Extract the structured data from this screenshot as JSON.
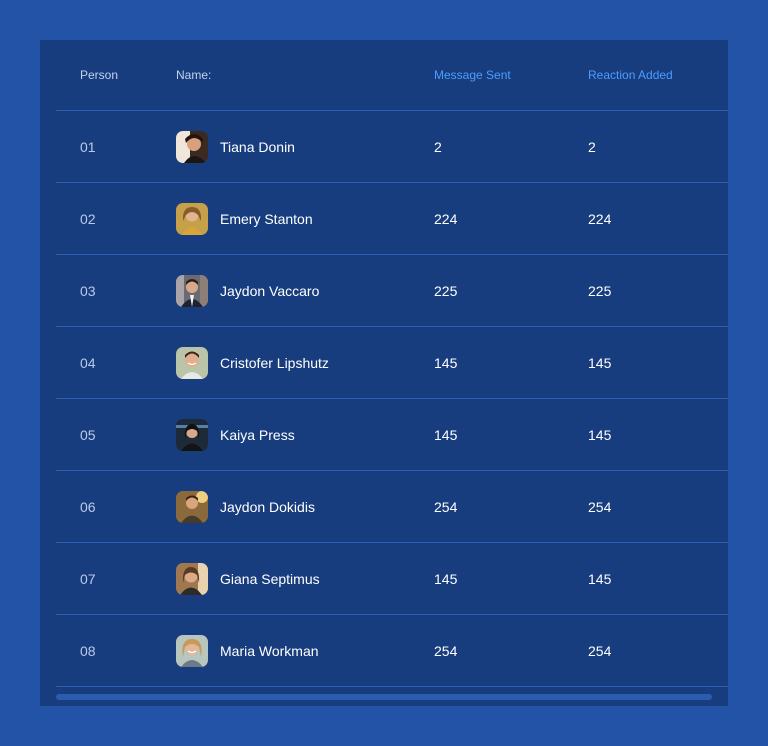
{
  "table": {
    "headers": {
      "person": "Person",
      "name": "Name:",
      "message_sent": "Message Sent",
      "reaction_added": "Reaction Added"
    },
    "rows": [
      {
        "person": "01",
        "name": "Tiana Donin",
        "message_sent": "2",
        "reaction_added": "2"
      },
      {
        "person": "02",
        "name": "Emery Stanton",
        "message_sent": "224",
        "reaction_added": "224"
      },
      {
        "person": "03",
        "name": "Jaydon Vaccaro",
        "message_sent": "225",
        "reaction_added": "225"
      },
      {
        "person": "04",
        "name": "Cristofer Lipshutz",
        "message_sent": "145",
        "reaction_added": "145"
      },
      {
        "person": "05",
        "name": "Kaiya Press",
        "message_sent": "145",
        "reaction_added": "145"
      },
      {
        "person": "06",
        "name": "Jaydon Dokidis",
        "message_sent": "254",
        "reaction_added": "254"
      },
      {
        "person": "07",
        "name": "Giana Septimus",
        "message_sent": "145",
        "reaction_added": "145"
      },
      {
        "person": "08",
        "name": "Maria Workman",
        "message_sent": "254",
        "reaction_added": "254"
      }
    ]
  },
  "colors": {
    "page_background": "#2253a6",
    "panel_background": "#173d7e",
    "accent": "#4d9dff",
    "divider": "#2c5fb3"
  }
}
